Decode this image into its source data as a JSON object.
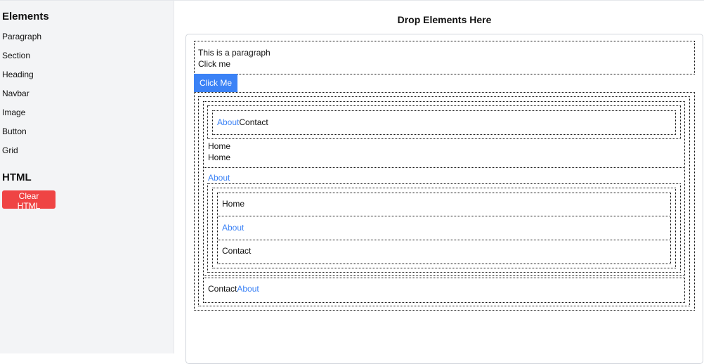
{
  "sidebar": {
    "elements_title": "Elements",
    "items": [
      {
        "label": "Paragraph"
      },
      {
        "label": "Section"
      },
      {
        "label": "Heading"
      },
      {
        "label": "Navbar"
      },
      {
        "label": "Image"
      },
      {
        "label": "Button"
      },
      {
        "label": "Grid"
      }
    ],
    "html_title": "HTML",
    "clear_label": "Clear HTML"
  },
  "canvas": {
    "title": "Drop Elements Here",
    "paragraph_text": "This is a paragraph",
    "paragraph_link": "Click me",
    "button_label": "Click Me",
    "nav1": {
      "about": "About",
      "contact": "Contact"
    },
    "home1": "Home",
    "home2": "Home",
    "about_link": "About",
    "list_home": "Home",
    "list_about": "About",
    "list_contact": "Contact",
    "nav2": {
      "contact": "Contact",
      "about": "About"
    }
  },
  "colors": {
    "link": "#3b82f6",
    "primary_button": "#3b82f6",
    "danger_button": "#ef4444",
    "sidebar_bg": "#f3f4f6"
  }
}
